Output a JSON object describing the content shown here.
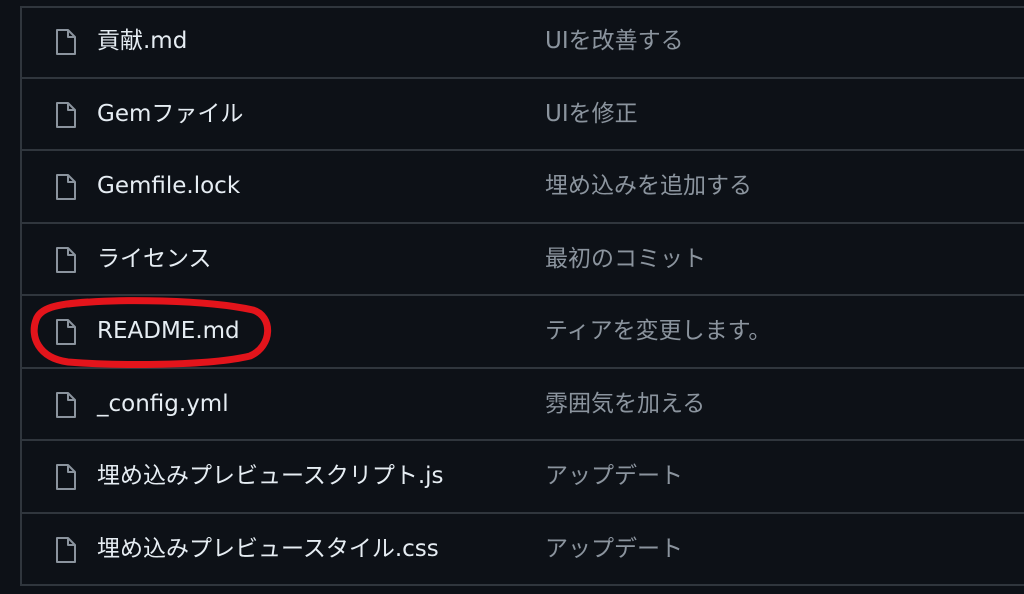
{
  "file_list": {
    "rows": [
      {
        "name": "貢献.md",
        "commit_message": "UIを改善する",
        "icon": "file-icon"
      },
      {
        "name": "Gemファイル",
        "commit_message": "UIを修正",
        "icon": "file-icon"
      },
      {
        "name": "Gemfile.lock",
        "commit_message": "埋め込みを追加する",
        "icon": "file-icon"
      },
      {
        "name": "ライセンス",
        "commit_message": "最初のコミット",
        "icon": "file-icon"
      },
      {
        "name": "README.md",
        "commit_message": "ティアを変更します。",
        "icon": "file-icon",
        "highlighted": true
      },
      {
        "name": "_config.yml",
        "commit_message": "雰囲気を加える",
        "icon": "file-icon"
      },
      {
        "name": "埋め込みプレビュースクリプト.js",
        "commit_message": "アップデート",
        "icon": "file-icon"
      },
      {
        "name": "埋め込みプレビュースタイル.css",
        "commit_message": "アップデート",
        "icon": "file-icon"
      }
    ]
  },
  "colors": {
    "background": "#0d1117",
    "border": "#30363d",
    "filename_text": "#e6edf3",
    "commit_text": "#8b949e",
    "icon": "#8b949e",
    "annotation_red": "#e3141b"
  }
}
